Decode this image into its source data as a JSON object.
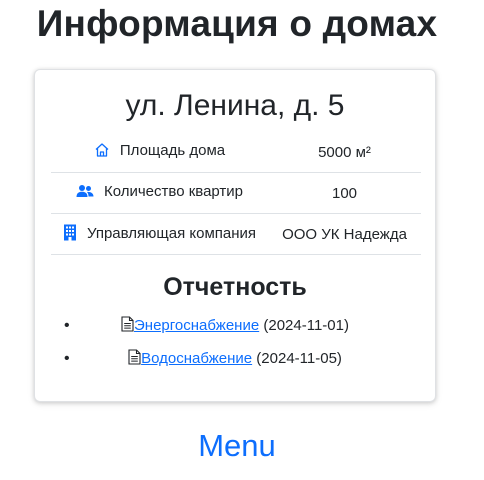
{
  "page": {
    "title": "Информация о домах"
  },
  "house": {
    "address": "ул. Ленина, д. 5",
    "info_rows": [
      {
        "icon": "house-icon",
        "label": "Площадь дома",
        "value": "5000 м²"
      },
      {
        "icon": "people-icon",
        "label": "Количество квартир",
        "value": "100"
      },
      {
        "icon": "building-icon",
        "label": "Управляющая компания",
        "value": "ООО УК Надежда"
      }
    ]
  },
  "reports": {
    "title": "Отчетность",
    "items": [
      {
        "icon": "document-icon",
        "link_text": "Энергоснабжение",
        "date": "(2024-11-01)"
      },
      {
        "icon": "document-icon",
        "link_text": "Водоснабжение",
        "date": "(2024-11-05)"
      }
    ]
  },
  "menu": {
    "label": "Menu"
  },
  "colors": {
    "link": "#0d6efd",
    "icon": "#0d6efd",
    "text": "#212529"
  }
}
